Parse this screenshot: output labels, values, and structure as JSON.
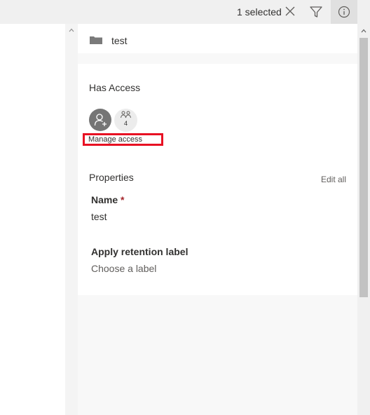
{
  "command_bar": {
    "selection_text": "1 selected",
    "clear_icon": "close-icon",
    "filter_icon": "filter-icon",
    "info_icon": "info-icon"
  },
  "details": {
    "file": {
      "icon": "folder-icon",
      "name": "test"
    },
    "access": {
      "title": "Has Access",
      "shared_count": "4",
      "manage_label": "Manage access"
    },
    "properties": {
      "title": "Properties",
      "edit_all_label": "Edit all",
      "name_label": "Name",
      "required_marker": "*",
      "name_value": "test",
      "retention_label": "Apply retention label",
      "retention_placeholder": "Choose a label"
    }
  },
  "colors": {
    "highlight_border": "#e81123",
    "avatar_bg": "#757575",
    "required": "#a4262c"
  }
}
